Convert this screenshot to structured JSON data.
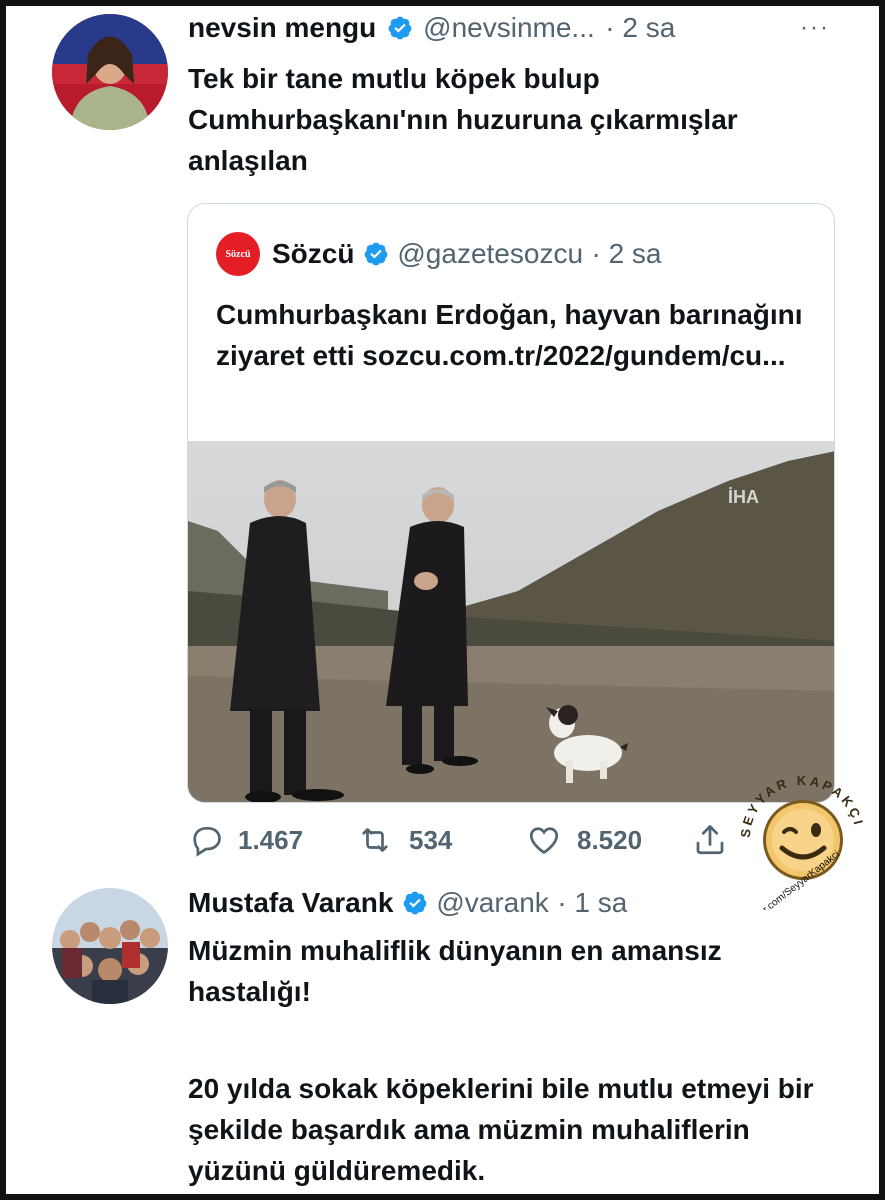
{
  "tweet1": {
    "name": "nevsin mengu",
    "handle": "@nevsinme...",
    "time": "· 2 sa",
    "more": "···",
    "text": "Tek bir tane mutlu köpek bulup Cumhurbaşkanı'nın huzuruna çıkarmışlar anlaşılan"
  },
  "quote": {
    "logo_text": "Sözcü",
    "name": "Sözcü",
    "handle": "@gazetesozcu",
    "time": "· 2 sa",
    "text": "Cumhurbaşkanı Erdoğan, hayvan barınağını ziyaret etti sozcu.com.tr/2022/gundem/cu...",
    "photo_label": "İHA"
  },
  "actions": {
    "replies": "1.467",
    "retweets": "534",
    "likes": "8.520"
  },
  "tweet2": {
    "name": "Mustafa Varank",
    "handle": "@varank",
    "time": "· 1 sa",
    "text_line1": "Müzmin muhaliflik dünyanın en amansız hastalığı!",
    "text_line2": "20 yılda sokak köpeklerini bile mutlu etmeyi bir şekilde başardık ama müzmin muhaliflerin yüzünü güldüremedik."
  },
  "watermark": {
    "brand": "SEYYAR KAPAKÇI",
    "url": "twitter.com/SeyyarKapakci"
  },
  "colors": {
    "verified": "#1d9bf0",
    "text": "#0f1419",
    "secondary": "#536471",
    "border": "#cfd9de",
    "sozcu_red": "#e31e24"
  }
}
